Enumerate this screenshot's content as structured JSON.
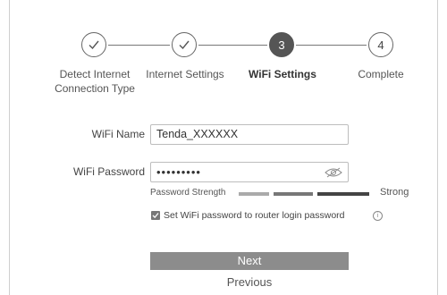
{
  "stepper": {
    "steps": [
      {
        "label_line1": "Detect Internet",
        "label_line2": "Connection Type",
        "status": "done"
      },
      {
        "label_line1": "Internet Settings",
        "label_line2": "",
        "status": "done"
      },
      {
        "number": "3",
        "label_line1": "WiFi Settings",
        "label_line2": "",
        "status": "active"
      },
      {
        "number": "4",
        "label_line1": "Complete",
        "label_line2": "",
        "status": "pending"
      }
    ]
  },
  "form": {
    "wifi_name": {
      "label": "WiFi Name",
      "value": "Tenda_XXXXXX"
    },
    "wifi_password": {
      "label": "WiFi Password",
      "value": "•••••••••",
      "icon": "eye-icon"
    },
    "strength": {
      "label": "Password Strength",
      "strong_label": "Strong",
      "levels": [
        "weak",
        "medium",
        "strong"
      ],
      "current_level": 3
    },
    "router_password_option": {
      "label": "Set WiFi password to router login password",
      "checked": true,
      "info_symbol": "i"
    }
  },
  "actions": {
    "next_label": "Next",
    "previous_label": "Previous"
  },
  "colors": {
    "active": "#555555",
    "bar_light": "#aaaaaa",
    "bar_mid": "#777777",
    "bar_dark": "#444444",
    "button": "#8c8c8c"
  }
}
